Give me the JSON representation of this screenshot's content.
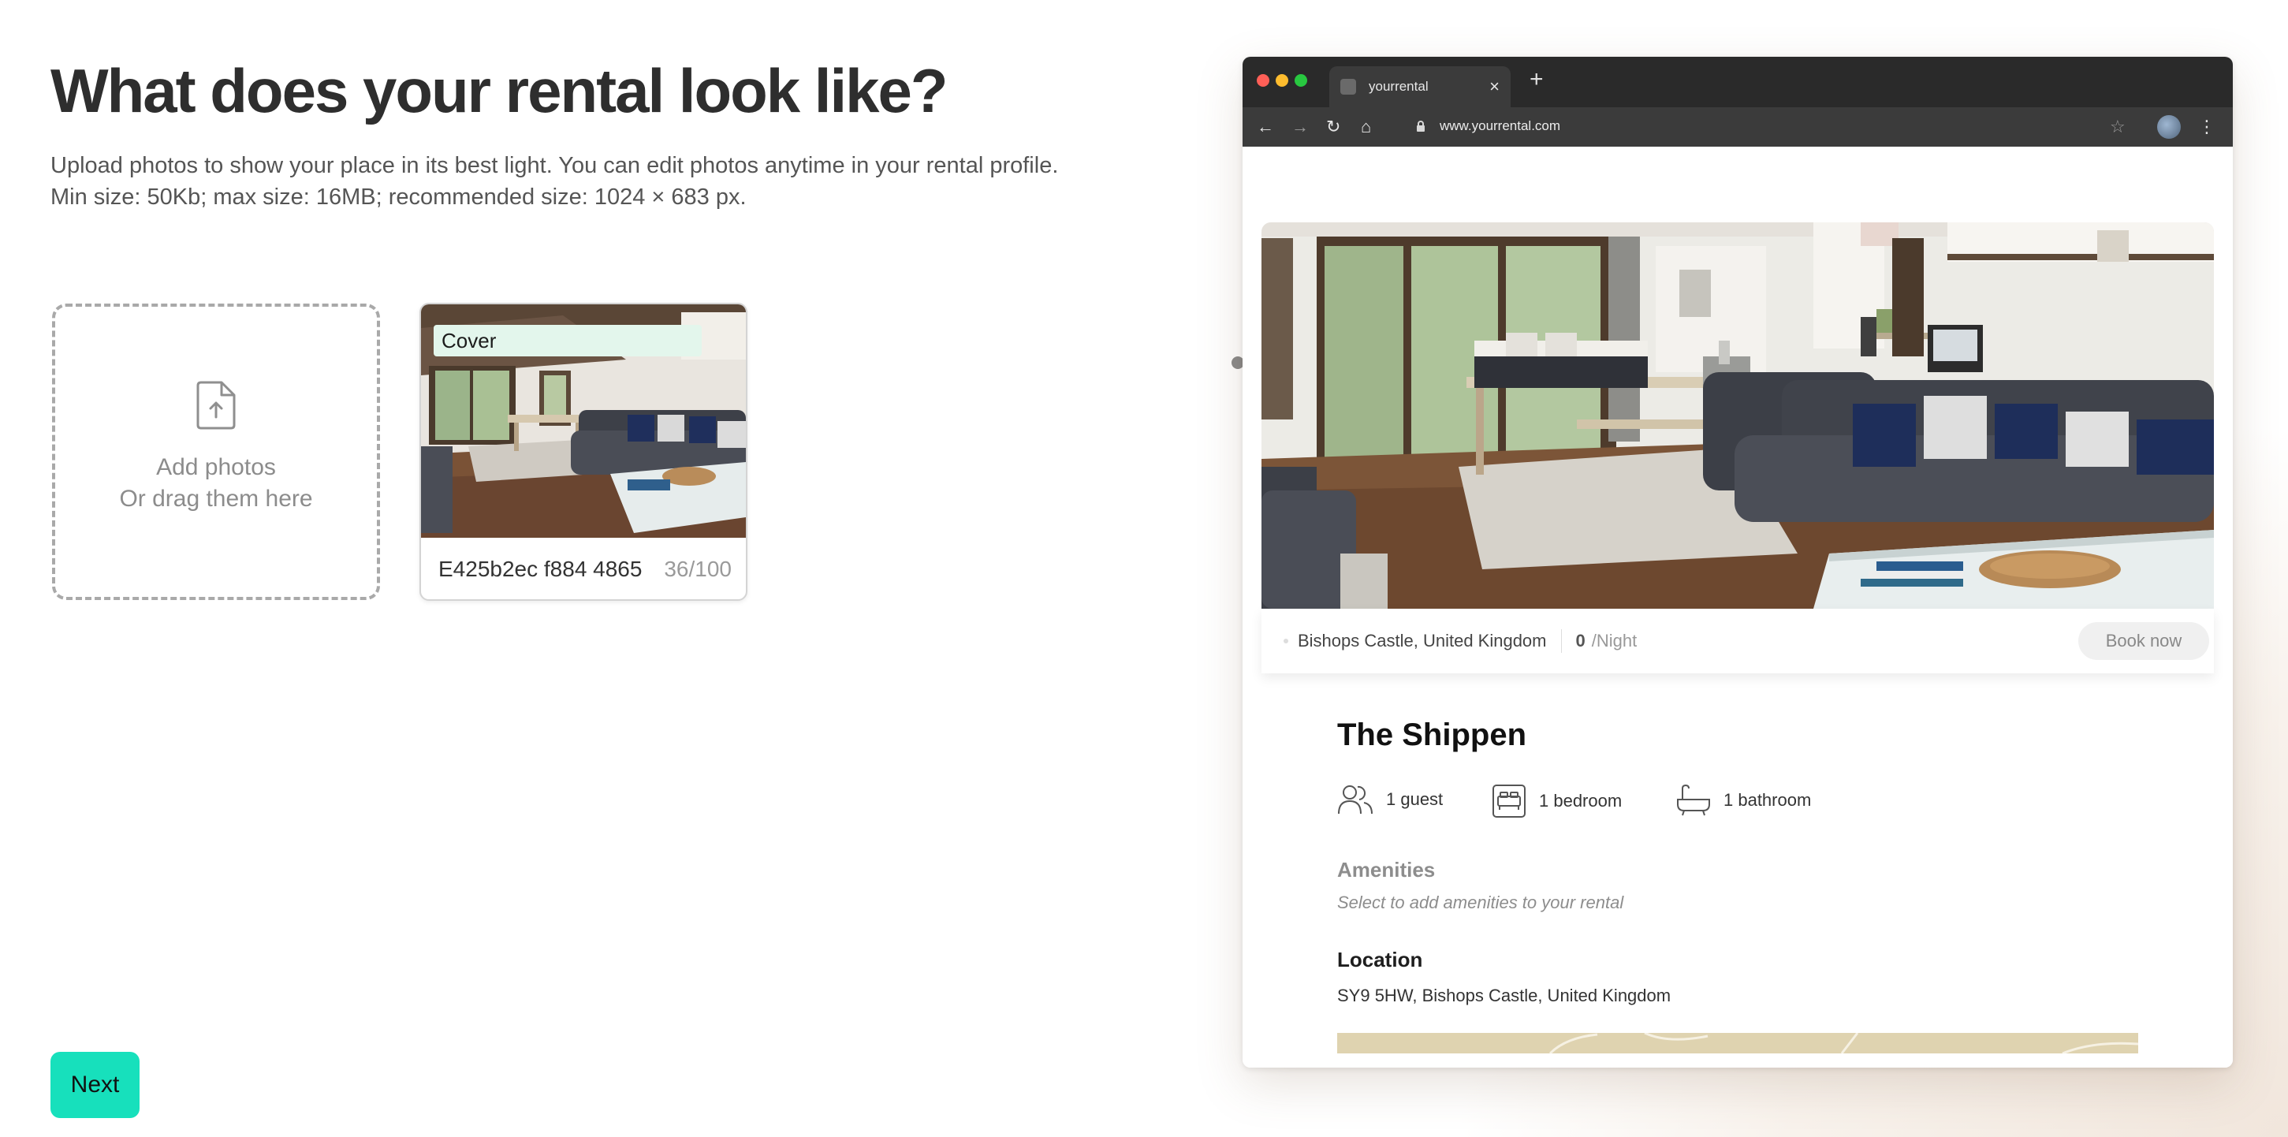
{
  "page": {
    "heading": "What does your rental look like?",
    "subtitle": "Upload photos to show your place in its best light. You can edit photos anytime in your rental profile. Min size: 50Kb; max size: 16MB; recommended size: 1024 × 683 px."
  },
  "upload": {
    "line1": "Add photos",
    "line2": "Or drag them here"
  },
  "photo": {
    "badge": "Cover",
    "caption_value": "E425b2ec f884 4865",
    "char_count": "36/100"
  },
  "actions": {
    "next_label": "Next"
  },
  "browser": {
    "tab_title": "yourrental",
    "tab_close": "×",
    "new_tab": "+",
    "url": "www.yourrental.com",
    "icons": [
      "back-icon",
      "forward-icon",
      "reload-icon",
      "home-icon",
      "lock-icon",
      "star-icon",
      "avatar",
      "more-icon"
    ]
  },
  "preview": {
    "location": "Bishops Castle, United Kingdom",
    "price": "0",
    "price_unit": "/Night",
    "book_label": "Book now",
    "title": "The Shippen",
    "features": {
      "guests": "1 guest",
      "bedrooms": "1 bedroom",
      "bathrooms": "1 bathroom"
    },
    "amenities_heading": "Amenities",
    "amenities_hint": "Select to add amenities to your rental",
    "location_heading": "Location",
    "location_address": "SY9 5HW, Bishops Castle, United Kingdom"
  },
  "colors": {
    "accent": "#17e0bc",
    "cover_badge": "#e3f6ec",
    "browser_chrome": "#2a2a2a",
    "traffic_red": "#ff5f57",
    "traffic_yellow": "#febc2e",
    "traffic_green": "#28c840"
  }
}
